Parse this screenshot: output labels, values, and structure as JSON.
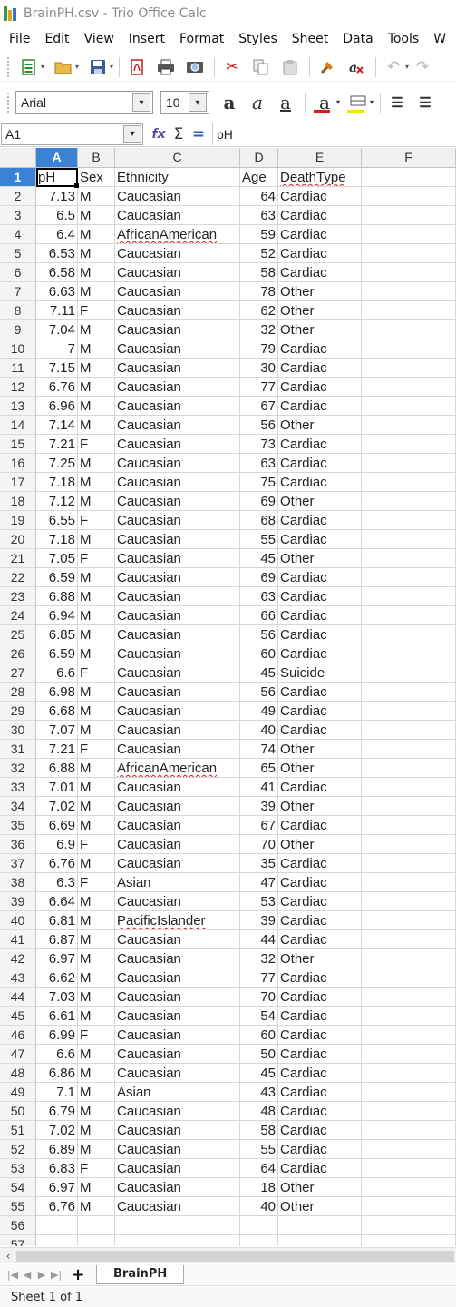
{
  "window": {
    "title": "BrainPH.csv - Trio Office Calc"
  },
  "menu": {
    "items": [
      "File",
      "Edit",
      "View",
      "Insert",
      "Format",
      "Styles",
      "Sheet",
      "Data",
      "Tools",
      "W"
    ]
  },
  "toolbar": {
    "icons": [
      "new-document-icon",
      "open-folder-icon",
      "save-icon",
      "export-pdf-icon",
      "print-icon",
      "print-preview-icon",
      "cut-icon",
      "copy-icon",
      "paste-icon",
      "clone-formatting-icon",
      "clear-formatting-icon",
      "undo-icon",
      "redo-icon"
    ]
  },
  "formatting": {
    "font_name": "Arial",
    "font_size": "10",
    "highlight_color": "#d42020",
    "background_color": "#f2e600"
  },
  "formula_bar": {
    "name_box": "A1",
    "content": "pH"
  },
  "sheet": {
    "columns": [
      "A",
      "B",
      "C",
      "D",
      "E",
      "F"
    ],
    "selected_column": "A",
    "selected_cell": "A1",
    "header_row": [
      "pH",
      "Sex",
      "Ethnicity",
      "Age",
      "DeathType"
    ],
    "data": [
      [
        "7.13",
        "M",
        "Caucasian",
        "64",
        "Cardiac"
      ],
      [
        "6.5",
        "M",
        "Caucasian",
        "63",
        "Cardiac"
      ],
      [
        "6.4",
        "M",
        "AfricanAmerican",
        "59",
        "Cardiac"
      ],
      [
        "6.53",
        "M",
        "Caucasian",
        "52",
        "Cardiac"
      ],
      [
        "6.58",
        "M",
        "Caucasian",
        "58",
        "Cardiac"
      ],
      [
        "6.63",
        "M",
        "Caucasian",
        "78",
        "Other"
      ],
      [
        "7.11",
        "F",
        "Caucasian",
        "62",
        "Other"
      ],
      [
        "7.04",
        "M",
        "Caucasian",
        "32",
        "Other"
      ],
      [
        "7",
        "M",
        "Caucasian",
        "79",
        "Cardiac"
      ],
      [
        "7.15",
        "M",
        "Caucasian",
        "30",
        "Cardiac"
      ],
      [
        "6.76",
        "M",
        "Caucasian",
        "77",
        "Cardiac"
      ],
      [
        "6.96",
        "M",
        "Caucasian",
        "67",
        "Cardiac"
      ],
      [
        "7.14",
        "M",
        "Caucasian",
        "56",
        "Other"
      ],
      [
        "7.21",
        "F",
        "Caucasian",
        "73",
        "Cardiac"
      ],
      [
        "7.25",
        "M",
        "Caucasian",
        "63",
        "Cardiac"
      ],
      [
        "7.18",
        "M",
        "Caucasian",
        "75",
        "Cardiac"
      ],
      [
        "7.12",
        "M",
        "Caucasian",
        "69",
        "Other"
      ],
      [
        "6.55",
        "F",
        "Caucasian",
        "68",
        "Cardiac"
      ],
      [
        "7.18",
        "M",
        "Caucasian",
        "55",
        "Cardiac"
      ],
      [
        "7.05",
        "F",
        "Caucasian",
        "45",
        "Other"
      ],
      [
        "6.59",
        "M",
        "Caucasian",
        "69",
        "Cardiac"
      ],
      [
        "6.88",
        "M",
        "Caucasian",
        "63",
        "Cardiac"
      ],
      [
        "6.94",
        "M",
        "Caucasian",
        "66",
        "Cardiac"
      ],
      [
        "6.85",
        "M",
        "Caucasian",
        "56",
        "Cardiac"
      ],
      [
        "6.59",
        "M",
        "Caucasian",
        "60",
        "Cardiac"
      ],
      [
        "6.6",
        "F",
        "Caucasian",
        "45",
        "Suicide"
      ],
      [
        "6.98",
        "M",
        "Caucasian",
        "56",
        "Cardiac"
      ],
      [
        "6.68",
        "M",
        "Caucasian",
        "49",
        "Cardiac"
      ],
      [
        "7.07",
        "M",
        "Caucasian",
        "40",
        "Cardiac"
      ],
      [
        "7.21",
        "F",
        "Caucasian",
        "74",
        "Other"
      ],
      [
        "6.88",
        "M",
        "AfricanAmerican",
        "65",
        "Other"
      ],
      [
        "7.01",
        "M",
        "Caucasian",
        "41",
        "Cardiac"
      ],
      [
        "7.02",
        "M",
        "Caucasian",
        "39",
        "Other"
      ],
      [
        "6.69",
        "M",
        "Caucasian",
        "67",
        "Cardiac"
      ],
      [
        "6.9",
        "F",
        "Caucasian",
        "70",
        "Other"
      ],
      [
        "6.76",
        "M",
        "Caucasian",
        "35",
        "Cardiac"
      ],
      [
        "6.3",
        "F",
        "Asian",
        "47",
        "Cardiac"
      ],
      [
        "6.64",
        "M",
        "Caucasian",
        "53",
        "Cardiac"
      ],
      [
        "6.81",
        "M",
        "PacificIslander",
        "39",
        "Cardiac"
      ],
      [
        "6.87",
        "M",
        "Caucasian",
        "44",
        "Cardiac"
      ],
      [
        "6.97",
        "M",
        "Caucasian",
        "32",
        "Other"
      ],
      [
        "6.62",
        "M",
        "Caucasian",
        "77",
        "Cardiac"
      ],
      [
        "7.03",
        "M",
        "Caucasian",
        "70",
        "Cardiac"
      ],
      [
        "6.61",
        "M",
        "Caucasian",
        "54",
        "Cardiac"
      ],
      [
        "6.99",
        "F",
        "Caucasian",
        "60",
        "Cardiac"
      ],
      [
        "6.6",
        "M",
        "Caucasian",
        "50",
        "Cardiac"
      ],
      [
        "6.86",
        "M",
        "Caucasian",
        "45",
        "Cardiac"
      ],
      [
        "7.1",
        "M",
        "Asian",
        "43",
        "Cardiac"
      ],
      [
        "6.79",
        "M",
        "Caucasian",
        "48",
        "Cardiac"
      ],
      [
        "7.02",
        "M",
        "Caucasian",
        "58",
        "Cardiac"
      ],
      [
        "6.89",
        "M",
        "Caucasian",
        "55",
        "Cardiac"
      ],
      [
        "6.83",
        "F",
        "Caucasian",
        "64",
        "Cardiac"
      ],
      [
        "6.97",
        "M",
        "Caucasian",
        "18",
        "Other"
      ],
      [
        "6.76",
        "M",
        "Caucasian",
        "40",
        "Other"
      ]
    ],
    "empty_rows": [
      "56",
      "57"
    ],
    "misspelled_words": [
      "DeathType",
      "AfricanAmerican",
      "PacificIslander"
    ]
  },
  "tabs": {
    "add_label": "+",
    "sheets": [
      "BrainPH"
    ]
  },
  "status": {
    "text": "Sheet 1 of 1"
  }
}
